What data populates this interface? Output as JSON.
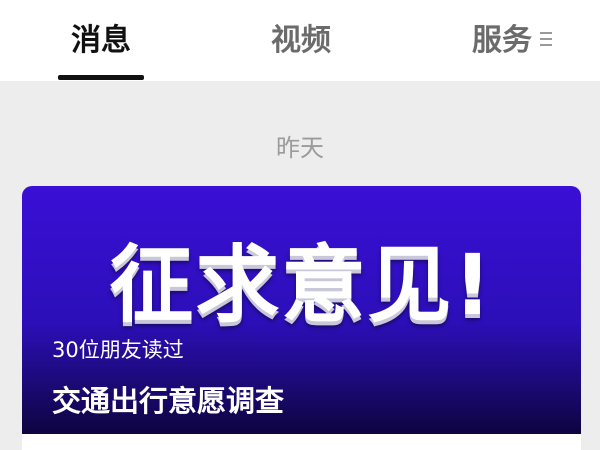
{
  "tabs": [
    {
      "label": "消息",
      "active": true
    },
    {
      "label": "视频",
      "active": false
    },
    {
      "label": "服务",
      "active": false
    }
  ],
  "more_icon": "hamburger-icon",
  "date_divider": "昨天",
  "article_card": {
    "banner_headline": "征求意见!",
    "read_count": "30位朋友读过",
    "title": "交通出行意愿调查",
    "banner_color": "#2c0fb8"
  }
}
